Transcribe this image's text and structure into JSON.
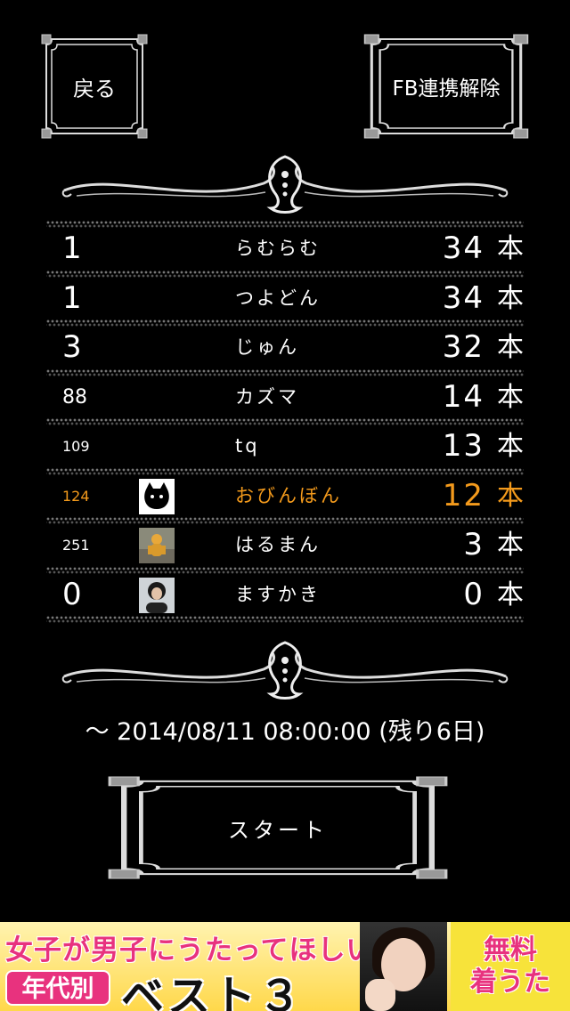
{
  "header": {
    "back_label": "戻る",
    "fb_label": "FB連携解除"
  },
  "ranking": [
    {
      "rank": "1",
      "name": "らむらむ",
      "count": "34",
      "unit": "本",
      "avatar": null,
      "me": false
    },
    {
      "rank": "1",
      "name": "つよどん",
      "count": "34",
      "unit": "本",
      "avatar": null,
      "me": false
    },
    {
      "rank": "3",
      "name": "じゅん",
      "count": "32",
      "unit": "本",
      "avatar": null,
      "me": false
    },
    {
      "rank": "88",
      "name": "カズマ",
      "count": "14",
      "unit": "本",
      "avatar": null,
      "me": false
    },
    {
      "rank": "109",
      "name": "tq",
      "count": "13",
      "unit": "本",
      "avatar": null,
      "me": false
    },
    {
      "rank": "124",
      "name": "おびんぼん",
      "count": "12",
      "unit": "本",
      "avatar": "cat",
      "me": true
    },
    {
      "rank": "251",
      "name": "はるまん",
      "count": "3",
      "unit": "本",
      "avatar": "figure",
      "me": false
    },
    {
      "rank": "0",
      "name": "ますかき",
      "count": "0",
      "unit": "本",
      "avatar": "person",
      "me": false
    }
  ],
  "period": {
    "text": "～ 2014/08/11 08:00:00 (残り6日)"
  },
  "start_label": "スタート",
  "ad": {
    "line1": "女子が男子にうたってほしい曲",
    "badge": "年代別",
    "line2": "ベスト３",
    "right_top": "無料",
    "right_bottom": "着うた"
  },
  "colors": {
    "background": "#000000",
    "text": "#ffffff",
    "highlight": "#f39a1c",
    "ad_pink": "#e8327e",
    "ad_yellow": "#f7e33a"
  }
}
